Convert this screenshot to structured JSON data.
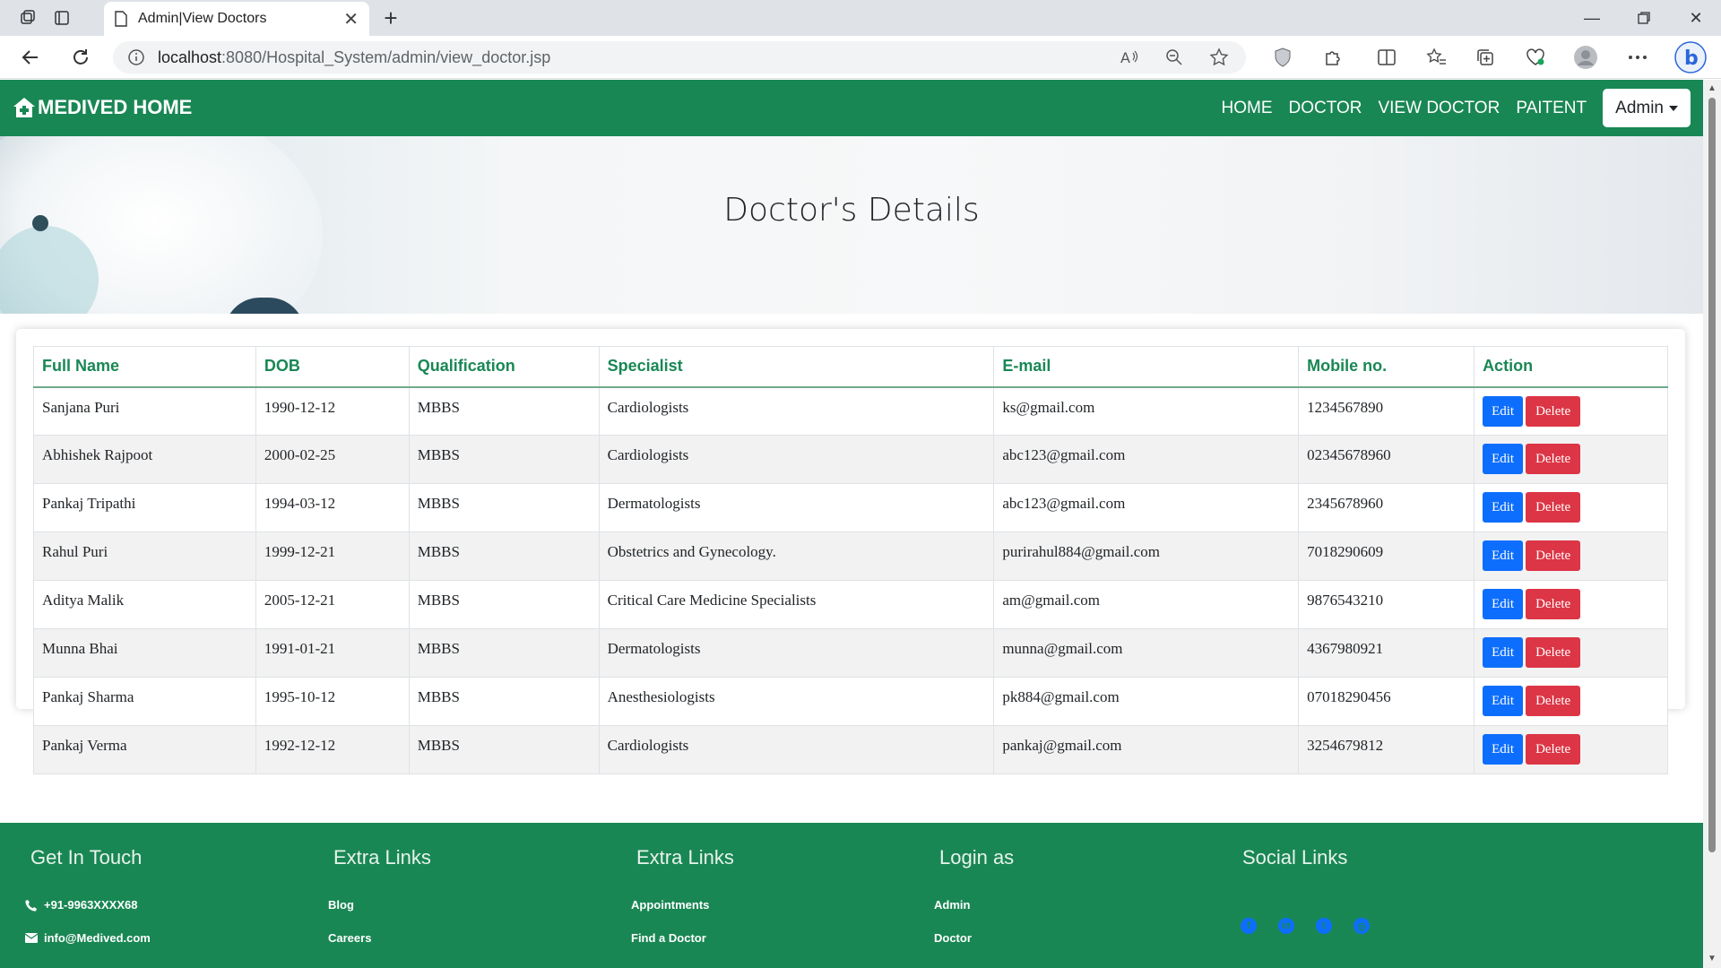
{
  "browser": {
    "tab_title": "Admin|View Doctors",
    "url_host": "localhost",
    "url_path": ":8080/Hospital_System/admin/view_doctor.jsp"
  },
  "navbar": {
    "brand": "MEDIVED HOME",
    "links": [
      "HOME",
      "DOCTOR",
      "VIEW DOCTOR",
      "PAITENT"
    ],
    "admin_label": "Admin"
  },
  "hero": {
    "title": "Doctor's Details"
  },
  "table": {
    "headers": [
      "Full Name",
      "DOB",
      "Qualification",
      "Specialist",
      "E-mail",
      "Mobile no.",
      "Action"
    ],
    "edit_label": "Edit",
    "delete_label": "Delete",
    "rows": [
      [
        "Sanjana Puri",
        "1990-12-12",
        "MBBS",
        "Cardiologists",
        "ks@gmail.com",
        "1234567890"
      ],
      [
        "Abhishek Rajpoot",
        "2000-02-25",
        "MBBS",
        "Cardiologists",
        "abc123@gmail.com",
        "02345678960"
      ],
      [
        "Pankaj Tripathi",
        "1994-03-12",
        "MBBS",
        "Dermatologists",
        "abc123@gmail.com",
        "2345678960"
      ],
      [
        "Rahul Puri",
        "1999-12-21",
        "MBBS",
        "Obstetrics and Gynecology.",
        "purirahul884@gmail.com",
        "7018290609"
      ],
      [
        "Aditya Malik",
        "2005-12-21",
        "MBBS",
        "Critical Care Medicine Specialists",
        "am@gmail.com",
        "9876543210"
      ],
      [
        "Munna Bhai",
        "1991-01-21",
        "MBBS",
        "Dermatologists",
        "munna@gmail.com",
        "4367980921"
      ],
      [
        "Pankaj Sharma",
        "1995-10-12",
        "MBBS",
        "Anesthesiologists",
        "pk884@gmail.com",
        "07018290456"
      ],
      [
        "Pankaj Verma",
        "1992-12-12",
        "MBBS",
        "Cardiologists",
        "pankaj@gmail.com",
        "3254679812"
      ]
    ]
  },
  "footer": {
    "get_in_touch": {
      "title": "Get In Touch",
      "phone": "+91-9963XXXX68",
      "email": "info@Medived.com"
    },
    "extra_links_1": {
      "title": "Extra Links",
      "items": [
        "Blog",
        "Careers"
      ]
    },
    "extra_links_2": {
      "title": "Extra Links",
      "items": [
        "Appointments",
        "Find a Doctor"
      ]
    },
    "login_as": {
      "title": "Login as",
      "items": [
        "Admin",
        "Doctor"
      ]
    },
    "social": {
      "title": "Social Links",
      "icons": [
        "facebook-icon",
        "linkedin-icon",
        "twitter-icon",
        "instagram-icon"
      ]
    }
  },
  "colors": {
    "brand_green": "#198754",
    "edit_blue": "#0d6efd",
    "delete_red": "#dc3545"
  }
}
